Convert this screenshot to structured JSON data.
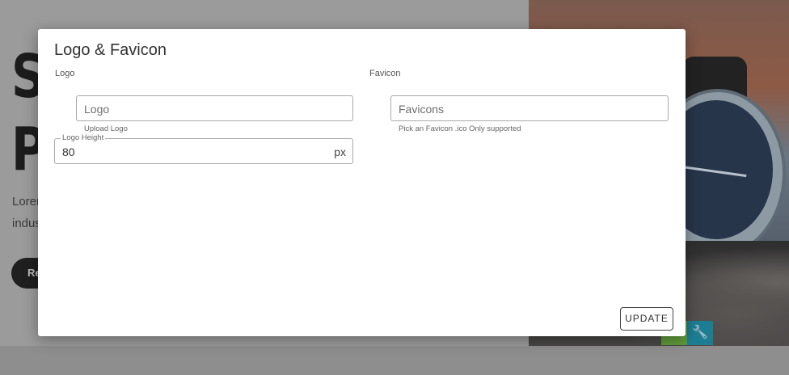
{
  "background": {
    "hero_letters": [
      "S",
      "P"
    ],
    "hero_lines": [
      "Lorem",
      "indus"
    ],
    "hero_button_label": "Re",
    "tool_icon": "wrench-icon",
    "tool_glyph": "🔧"
  },
  "modal": {
    "title": "Logo & Favicon",
    "logo_section_label": "Logo",
    "favicon_section_label": "Favicon",
    "logo_field": {
      "placeholder": "Logo",
      "helper": "Upload Logo"
    },
    "favicon_field": {
      "placeholder": "Favicons",
      "helper": "Pick an Favicon .ico Only supported"
    },
    "logo_height": {
      "label": "Logo Height",
      "value": "80",
      "unit": "px"
    },
    "update_label": "UPDATE"
  }
}
